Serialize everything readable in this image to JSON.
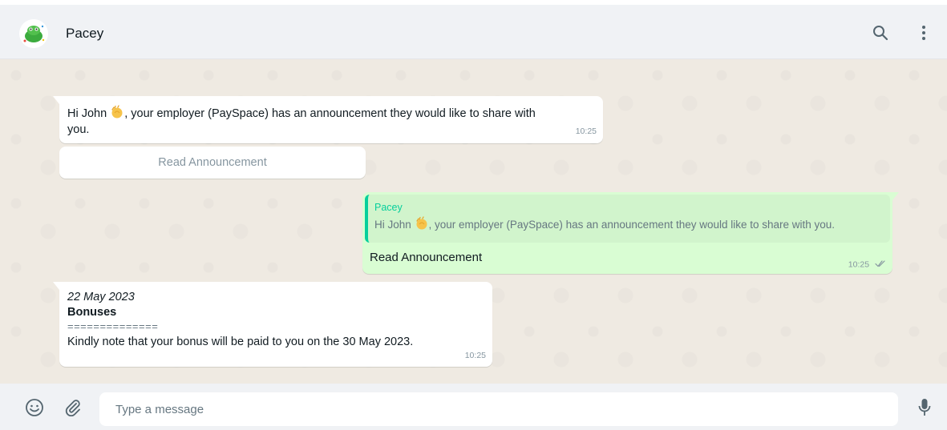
{
  "header": {
    "contact_name": "Pacey",
    "icons": [
      "avatar-logo",
      "search-icon",
      "more-vertical-icon"
    ]
  },
  "messages": {
    "incoming_1": {
      "text_before": "Hi John ",
      "emoji": "waving-hand",
      "text_after": ", your employer (PaySpace) has an announcement they would like to share with you.",
      "time": "10:25",
      "button_label": "Read Announcement"
    },
    "outgoing_1": {
      "quote_author": "Pacey",
      "quote_before": "Hi John ",
      "quote_emoji": "waving-hand",
      "quote_after": ", your employer (PaySpace) has an announcement they would like to share with you.",
      "text": "Read Announcement",
      "time": "10:25",
      "status": "read-double-check"
    },
    "incoming_2": {
      "date": "22 May 2023",
      "title": "Bonuses",
      "separator": "==============",
      "body": "Kindly note that your bonus will be paid to you on the 30 May 2023.",
      "time": "10:25"
    }
  },
  "composer": {
    "placeholder": "Type a message",
    "icons": [
      "emoji-icon",
      "attach-icon",
      "microphone-icon"
    ]
  },
  "colors": {
    "header_bg": "#f0f2f5",
    "chat_bg": "#efeae2",
    "outgoing_bg": "#d9fdd3",
    "quote_accent": "#06cf9c",
    "meta_text": "#8696a0"
  }
}
